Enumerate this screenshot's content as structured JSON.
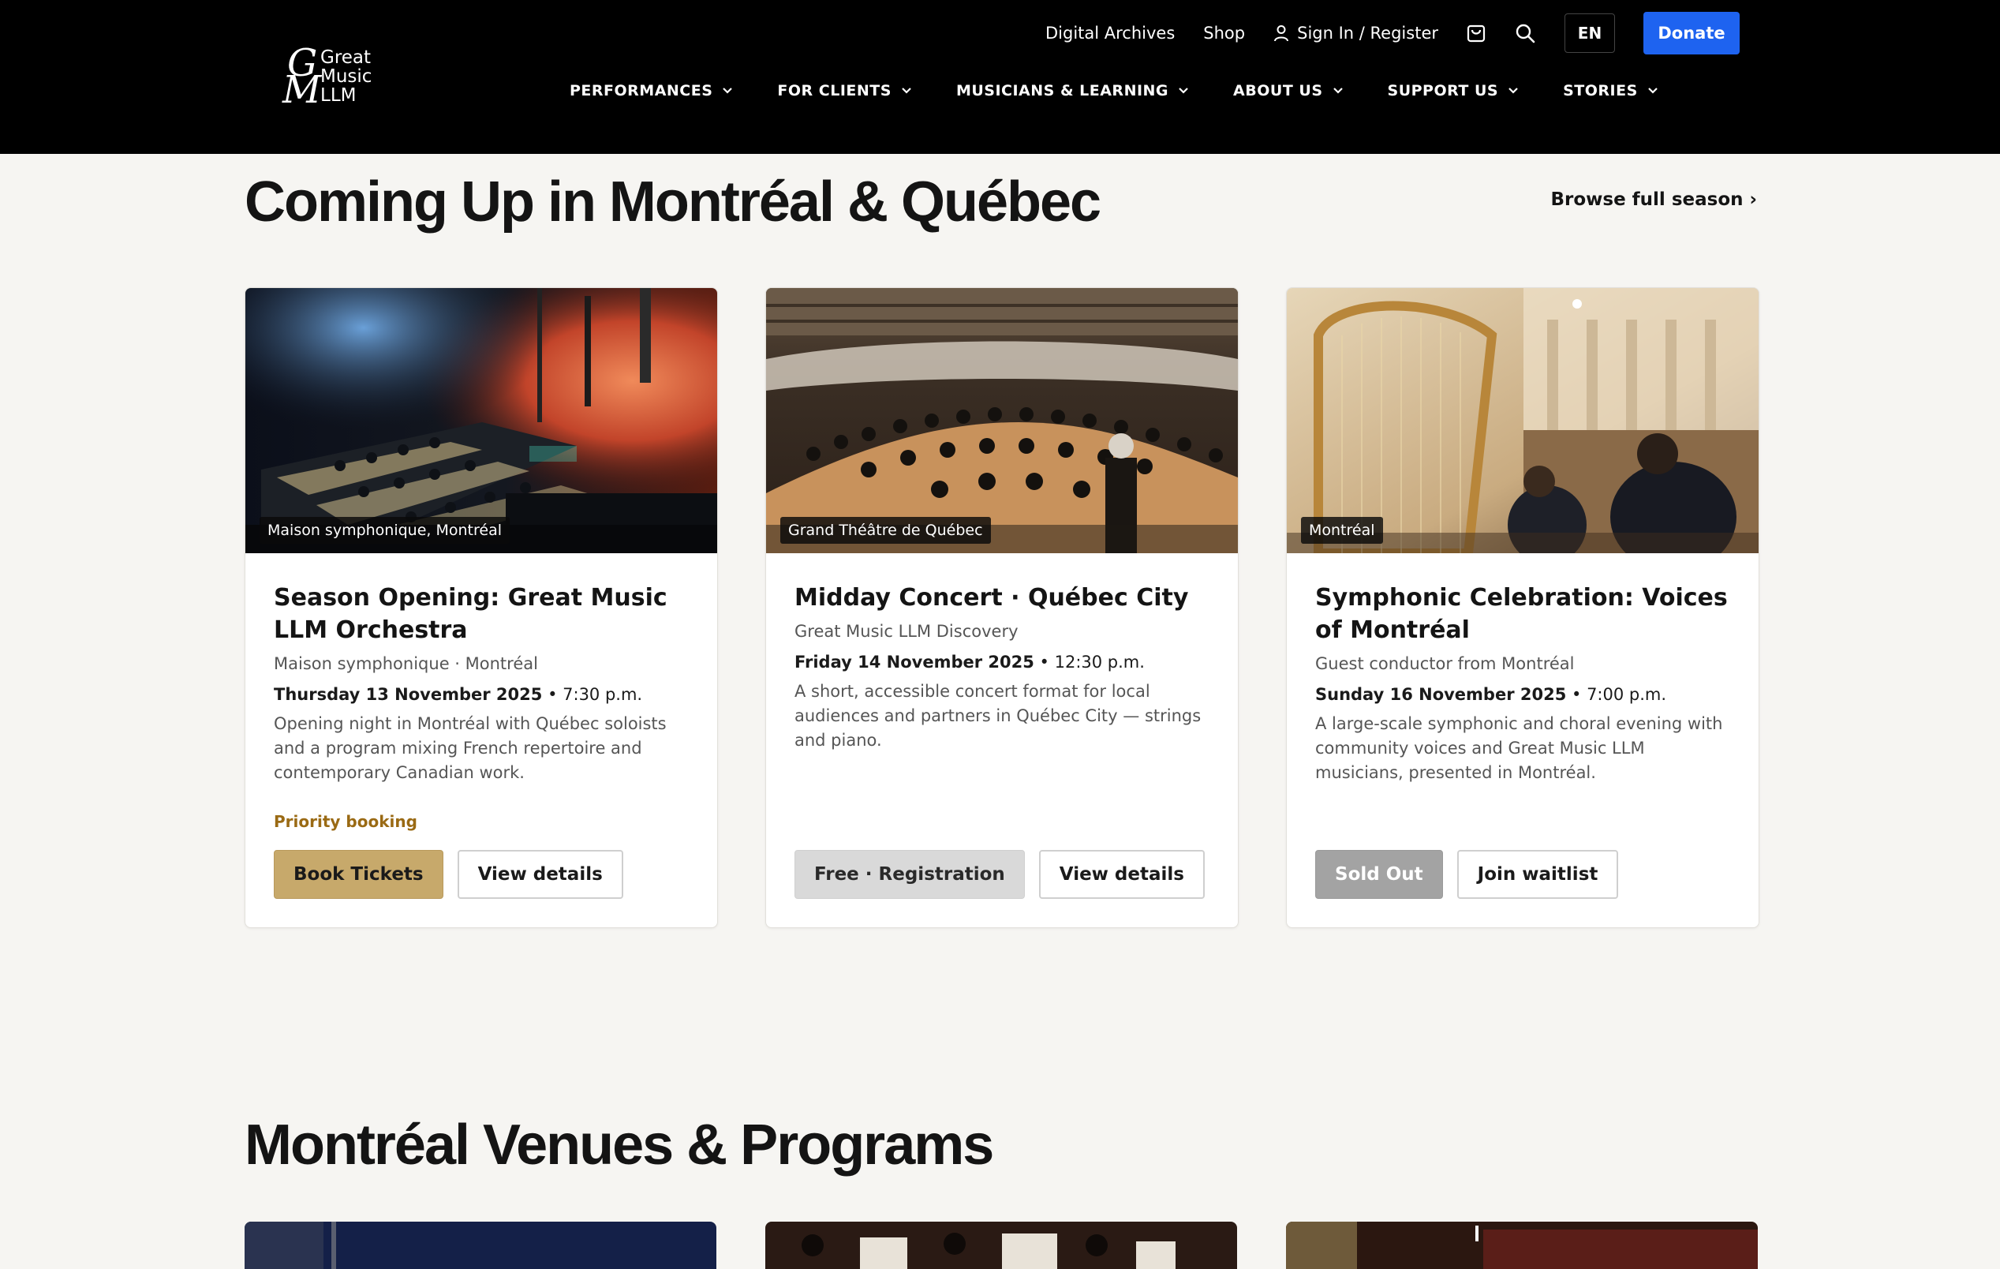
{
  "brand": {
    "logo_lines": [
      "Great",
      "Music",
      "LLM"
    ]
  },
  "utility_nav": {
    "links": [
      "Digital Archives",
      "Shop"
    ],
    "signin_label": "Sign In / Register",
    "language": "EN",
    "donate_label": "Donate"
  },
  "main_nav": {
    "items": [
      "PERFORMANCES",
      "FOR CLIENTS",
      "MUSICIANS & LEARNING",
      "ABOUT US",
      "SUPPORT US",
      "STORIES"
    ]
  },
  "coming_up": {
    "title": "Coming Up in Montréal & Québec",
    "browse_label": "Browse full season ›",
    "cards": [
      {
        "venue_tag": "Maison symphonique, Montréal",
        "title": "Season Opening: Great Music LLM Orchestra",
        "subtitle": "Maison symphonique · Montréal",
        "date": "Thursday 13 November 2025",
        "time": " • 7:30 p.m.",
        "description": "Opening night in Montréal with Québec soloists and a program mixing French repertoire and contemporary Canadian work.",
        "note": "Priority booking",
        "primary_button": "Book Tickets",
        "secondary_button": "View details"
      },
      {
        "venue_tag": "Grand Théâtre de Québec",
        "title": "Midday Concert · Québec City",
        "subtitle": "Great Music LLM Discovery",
        "date": "Friday 14 November 2025",
        "time": " • 12:30 p.m.",
        "description": "A short, accessible concert format for local audiences and partners in Québec City — strings and piano.",
        "primary_button": "Free · Registration",
        "secondary_button": "View details"
      },
      {
        "venue_tag": "Montréal",
        "title": "Symphonic Celebration: Voices of Montréal",
        "subtitle": "Guest conductor from Montréal",
        "date": "Sunday 16 November 2025",
        "time": " • 7:00 p.m.",
        "description": "A large-scale symphonic and choral evening with community voices and Great Music LLM musicians, presented in Montréal.",
        "primary_button": "Sold Out",
        "secondary_button": "Join waitlist"
      }
    ]
  },
  "venues": {
    "title": "Montréal Venues & Programs"
  }
}
